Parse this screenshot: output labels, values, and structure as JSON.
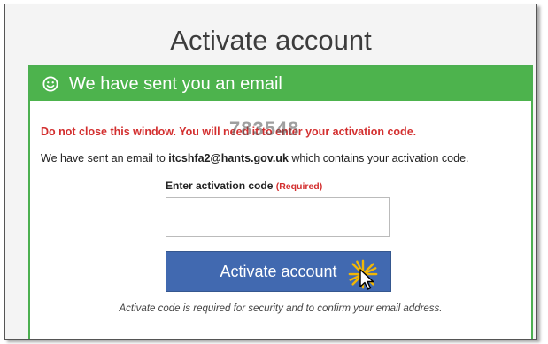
{
  "page": {
    "title": "Activate account"
  },
  "panel": {
    "heading": "We have sent you an email",
    "heading_icon": "smiley-icon",
    "warning": "Do not close this window. You will need it to enter your activation code.",
    "overlay_code": "783548",
    "info_prefix": "We have sent an email to ",
    "email": "itcshfa2@hants.gov.uk",
    "info_suffix": " which contains your activation code.",
    "field_label": "Enter activation code",
    "field_required": "(Required)",
    "field_value": "",
    "submit_label": "Activate account",
    "note": "Activate code is required for security and to confirm your email address."
  },
  "colors": {
    "header_green": "#4db34d",
    "button_blue": "#4169b0",
    "warning_red": "#d32f2f"
  }
}
